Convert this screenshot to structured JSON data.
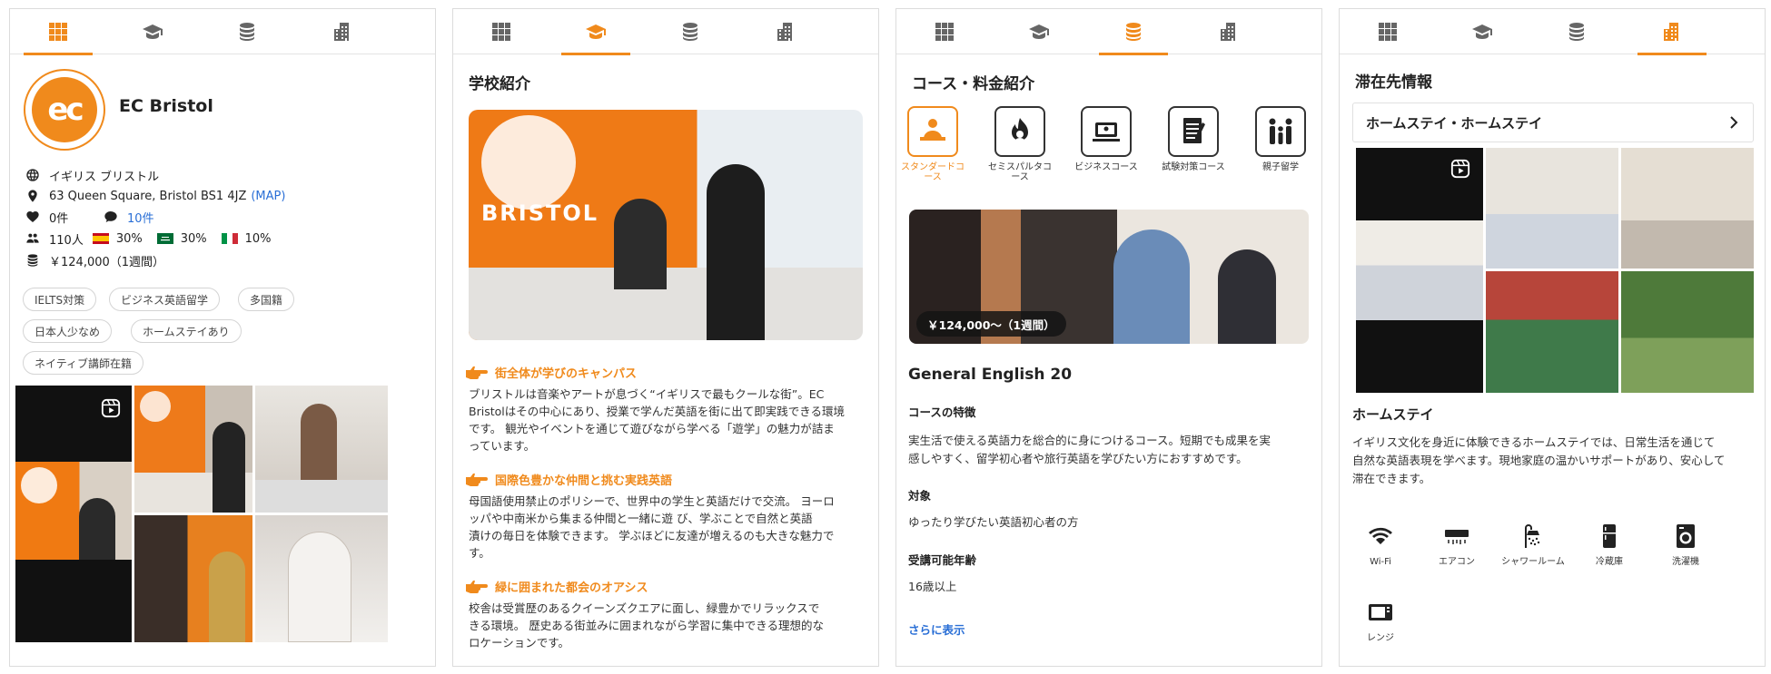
{
  "tabs": [
    {
      "name": "overview",
      "icon": "grid-icon"
    },
    {
      "name": "school",
      "icon": "graduation-cap-icon"
    },
    {
      "name": "courses",
      "icon": "coin-stack-icon"
    },
    {
      "name": "accommodation",
      "icon": "buildings-icon"
    }
  ],
  "colors": {
    "accent": "#f08a1c",
    "link": "#2a6fd6"
  },
  "panel1": {
    "logo_text": "ec",
    "school_name": "EC Bristol",
    "location": "イギリス ブリストル",
    "address": "63 Queen Square, Bristol BS1 4JZ",
    "map_link": "(MAP)",
    "likes": "0件",
    "reviews": "10件",
    "students": "110人",
    "nationality_1": "30%",
    "nationality_2": "30%",
    "nationality_3": "10%",
    "price": "￥124,000（1週間）",
    "tags": [
      "IELTS対策",
      "ビジネス英語留学",
      "多国籍",
      "日本人少なめ",
      "ホームステイあり",
      "ネイティブ講師在籍"
    ]
  },
  "panel2": {
    "title": "学校紹介",
    "photo_sign": "BRISTOL",
    "sections": [
      {
        "heading": "街全体が学びのキャンパス",
        "lines": [
          "ブリストルは音楽やアートが息づく“イギリスで最もクールな街”。EC",
          "Bristolはその中心にあり、授業で学んだ英語を街に出て即実践できる環境",
          "です。 観光やイベントを通じて遊びながら学べる「遊学」の魅力が詰ま",
          "っています。"
        ]
      },
      {
        "heading": "国際色豊かな仲間と挑む実践英語",
        "lines": [
          "母国語使用禁止のポリシーで、世界中の学生と英語だけで交流。 ヨーロ",
          "ッパや中南米から集まる仲間と一緒に遊 び、学ぶことで自然と英語",
          "漬けの毎日を体験できます。 学ぶほどに友達が増えるのも大きな魅力で",
          "す。"
        ]
      },
      {
        "heading": "緑に囲まれた都会のオアシス",
        "lines": [
          "校舎は受賞歴のあるクイーンズクエアに面し、緑豊かでリラックスで",
          "きる環境。 歴史ある街並みに囲まれながら学習に集中できる理想的な",
          "ロケーションです。"
        ]
      }
    ]
  },
  "panel3": {
    "title": "コース・料金紹介",
    "courses": [
      {
        "label": "スタンダードコース",
        "icon": "standard-course-icon"
      },
      {
        "label": "セミスパルタコース",
        "icon": "semi-sparta-course-icon"
      },
      {
        "label": "ビジネスコース",
        "icon": "business-course-icon"
      },
      {
        "label": "試験対策コース",
        "icon": "exam-course-icon"
      },
      {
        "label": "親子留学",
        "icon": "family-course-icon"
      }
    ],
    "price_badge": "￥124,000～（1週間）",
    "course_name": "General English 20",
    "features_heading": "コースの特徴",
    "features_text": [
      "実生活で使える英語力を総合的に身につけるコース。短期でも成果を実",
      "感しやすく、留学初心者や旅行英語を学びたい方におすすめです。"
    ],
    "target_heading": "対象",
    "target_text": "ゆったり学びたい英語初心者の方",
    "age_heading": "受講可能年齢",
    "age_text": "16歳以上",
    "more_link": "さらに表示"
  },
  "panel4": {
    "title": "滞在先情報",
    "selector": "ホームステイ・ホームステイ",
    "section_title": "ホームステイ",
    "description": [
      "イギリス文化を身近に体験できるホームステイでは、日常生活を通じて",
      "自然な英語表現を学べます。現地家庭の温かいサポートがあり、安心して",
      "滞在できます。"
    ],
    "amenities": [
      {
        "label": "Wi-Fi",
        "icon": "wifi-icon"
      },
      {
        "label": "エアコン",
        "icon": "air-conditioner-icon"
      },
      {
        "label": "シャワールーム",
        "icon": "shower-icon"
      },
      {
        "label": "冷蔵庫",
        "icon": "fridge-icon"
      },
      {
        "label": "洗濯機",
        "icon": "washing-machine-icon"
      },
      {
        "label": "レンジ",
        "icon": "microwave-icon"
      }
    ]
  }
}
